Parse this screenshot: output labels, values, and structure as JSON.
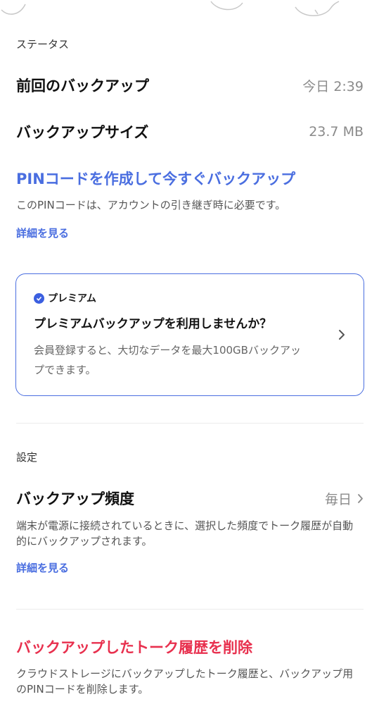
{
  "status": {
    "header": "ステータス",
    "last_backup_label": "前回のバックアップ",
    "last_backup_value": "今日 2:39",
    "backup_size_label": "バックアップサイズ",
    "backup_size_value": "23.7 MB"
  },
  "pin": {
    "action_label": "PINコードを作成して今すぐバックアップ",
    "description": "このPINコードは、アカウントの引き継ぎ時に必要です。",
    "detail_link": "詳細を見る"
  },
  "premium": {
    "brand": "プレミアム",
    "title": "プレミアムバックアップを利用しませんか？",
    "description": "会員登録すると、大切なデータを最大100GBバックアップできます。"
  },
  "settings": {
    "header": "設定",
    "frequency_label": "バックアップ頻度",
    "frequency_value": "毎日",
    "frequency_description": "端末が電源に接続されているときに、選択した頻度でトーク履歴が自動的にバックアップされます。",
    "detail_link": "詳細を見る"
  },
  "delete": {
    "action_label": "バックアップしたトーク履歴を削除",
    "description": "クラウドストレージにバックアップしたトーク履歴と、バックアップ用のPINコードを削除します。"
  },
  "colors": {
    "accent_blue": "#4a6ee0",
    "danger_red": "#e8304e"
  }
}
